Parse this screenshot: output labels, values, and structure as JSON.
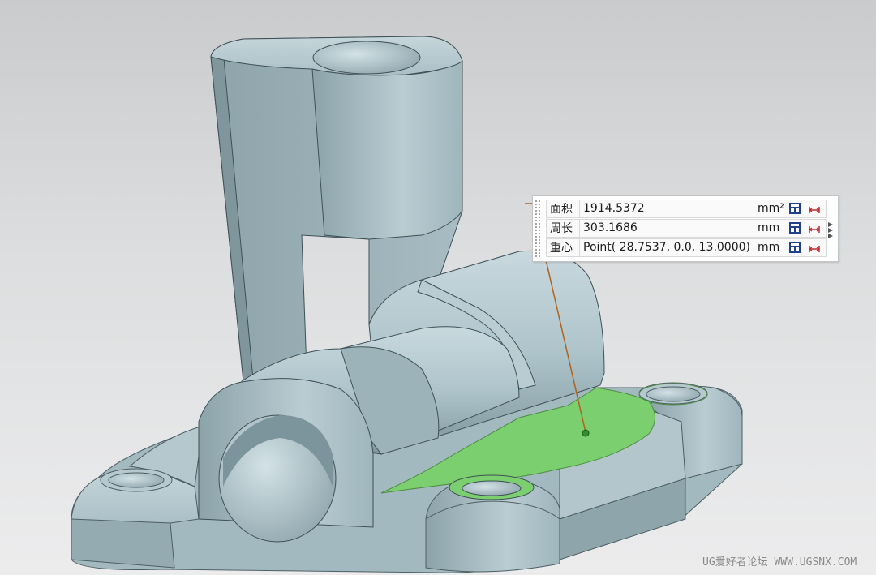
{
  "measurements": [
    {
      "label": "面积",
      "value": "1914.5372",
      "unit": "mm²"
    },
    {
      "label": "周长",
      "value": "303.1686",
      "unit": "mm"
    },
    {
      "label": "重心",
      "value": "Point( 28.7537, 0.0, 13.0000)",
      "unit": "mm"
    }
  ],
  "icons": {
    "export": "spreadsheet-export-icon",
    "measure": "measure-dimension-icon",
    "expand": "expand-arrows-icon"
  },
  "watermark": "UG爱好者论坛 WWW.UGSNX.COM",
  "colors": {
    "model": "#a9bfc6",
    "selected_face": "#7ccf6e",
    "leader_line": "#b0621e"
  }
}
